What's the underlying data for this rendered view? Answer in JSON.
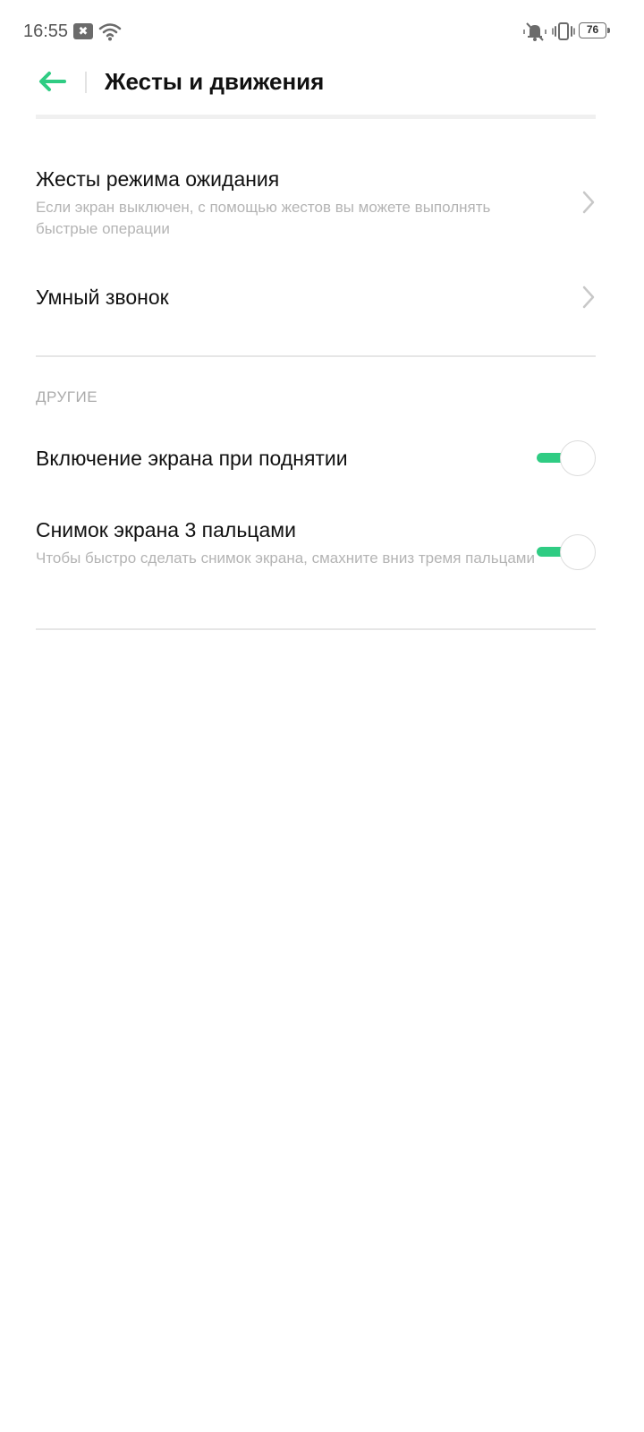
{
  "status_bar": {
    "time": "16:55",
    "notification_icon_glyph": "✖",
    "battery_level": "76"
  },
  "header": {
    "title": "Жесты и движения",
    "back_icon": "arrow-left-icon",
    "accent_color": "#2fcc83"
  },
  "gestures": {
    "items": [
      {
        "title": "Жесты режима ожидания",
        "subtitle": "Если экран выключен, с помощью жестов вы можете выполнять быстрые операции"
      },
      {
        "title": "Умный звонок"
      }
    ]
  },
  "other": {
    "section_label": "ДРУГИЕ",
    "items": [
      {
        "title": "Включение экрана при поднятии",
        "enabled": true
      },
      {
        "title": "Снимок экрана 3 пальцами",
        "subtitle": "Чтобы быстро сделать снимок экрана, смахните вниз тремя пальцами",
        "enabled": true
      }
    ]
  }
}
